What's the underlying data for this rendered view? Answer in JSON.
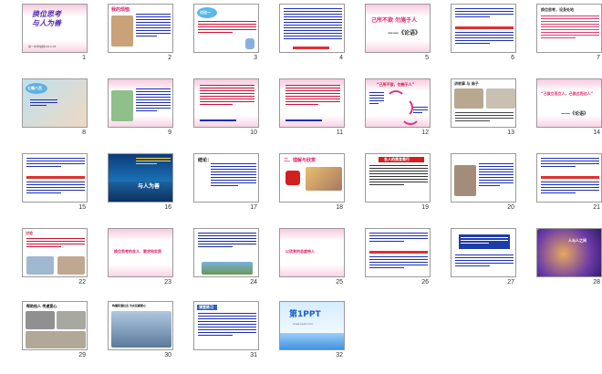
{
  "slides": [
    {
      "n": "1",
      "title": "换位思考\n与人为善",
      "subtitle": "第一中学编制2013.03"
    },
    {
      "n": "2",
      "title": "我的烦恼"
    },
    {
      "n": "3",
      "title": "讨论一"
    },
    {
      "n": "4",
      "title": ""
    },
    {
      "n": "5",
      "title": "己所不欲  勿施于人",
      "quote": "——《论语》"
    },
    {
      "n": "6",
      "title": ""
    },
    {
      "n": "7",
      "title": "换位思考，设身处地"
    },
    {
      "n": "8",
      "title": "七嘴八舌"
    },
    {
      "n": "9",
      "title": ""
    },
    {
      "n": "10",
      "title": ""
    },
    {
      "n": "11",
      "title": ""
    },
    {
      "n": "12",
      "title": "“己所不欲，勿施于人”"
    },
    {
      "n": "13",
      "title": "讲故事 与 翁子"
    },
    {
      "n": "14",
      "title": "“己欲立而立人，己欲达而达人”",
      "quote": "——《论语》"
    },
    {
      "n": "15",
      "title": "“己欲立而立人”"
    },
    {
      "n": "16",
      "title": "与人为善"
    },
    {
      "n": "17",
      "title": "结论："
    },
    {
      "n": "18",
      "title": "二、理解与欣赏"
    },
    {
      "n": "19",
      "title": "名人的美言美行"
    },
    {
      "n": "20",
      "title": ""
    },
    {
      "n": "21",
      "title": ""
    },
    {
      "n": "22",
      "title": "讨论"
    },
    {
      "n": "23",
      "title": "换位思考的含义、要求和实质"
    },
    {
      "n": "24",
      "title": ""
    },
    {
      "n": "25",
      "title": "以欣赏的态度待人"
    },
    {
      "n": "26",
      "title": ""
    },
    {
      "n": "27",
      "title": ""
    },
    {
      "n": "28",
      "title": "人与人之间"
    },
    {
      "n": "29",
      "title": "帮助他人 传递爱心"
    },
    {
      "n": "30",
      "title": "构建和谐社会 为灾区献爱心"
    },
    {
      "n": "31",
      "title": "课堂练习"
    },
    {
      "n": "32",
      "title": "第1PPT",
      "subtitle": "www.1ppt.com"
    }
  ],
  "colors": {
    "slide_border": "#9a9a9a",
    "title_red": "#e0206a",
    "title_blue": "#1a3fa8",
    "text_red": "#d0103a",
    "text_blue": "#1e2fb0",
    "slide_pink": "#fdf2f7"
  }
}
